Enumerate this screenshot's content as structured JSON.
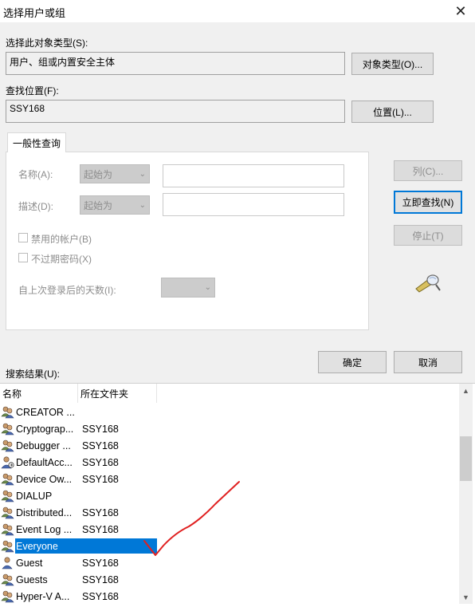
{
  "window": {
    "title": "选择用户或组",
    "close_glyph": "✕"
  },
  "object_type": {
    "label": "选择此对象类型(S):",
    "value": "用户、组或内置安全主体",
    "button": "对象类型(O)..."
  },
  "location": {
    "label": "查找位置(F):",
    "value": "SSY168",
    "button": "位置(L)..."
  },
  "tab": {
    "label": "一般性查询"
  },
  "query": {
    "name_label": "名称(A):",
    "name_combo": "起始为",
    "desc_label": "描述(D):",
    "desc_combo": "起始为",
    "disabled_accounts": "禁用的帐户(B)",
    "non_expiring": "不过期密码(X)",
    "days_label": "自上次登录后的天数(I):"
  },
  "buttons": {
    "columns": "列(C)...",
    "find_now": "立即查找(N)",
    "stop": "停止(T)",
    "ok": "确定",
    "cancel": "取消"
  },
  "results": {
    "label": "搜索结果(U):",
    "columns": [
      "名称",
      "所在文件夹"
    ],
    "rows": [
      {
        "name": "CREATOR ...",
        "folder": "",
        "icon": "group-icon"
      },
      {
        "name": "Cryptograp...",
        "folder": "SSY168",
        "icon": "group-icon"
      },
      {
        "name": "Debugger ...",
        "folder": "SSY168",
        "icon": "group-icon"
      },
      {
        "name": "DefaultAcc...",
        "folder": "SSY168",
        "icon": "user-disabled-icon"
      },
      {
        "name": "Device Ow...",
        "folder": "SSY168",
        "icon": "group-icon"
      },
      {
        "name": "DIALUP",
        "folder": "",
        "icon": "group-icon"
      },
      {
        "name": "Distributed...",
        "folder": "SSY168",
        "icon": "group-icon"
      },
      {
        "name": "Event Log ...",
        "folder": "SSY168",
        "icon": "group-icon"
      },
      {
        "name": "Everyone",
        "folder": "",
        "icon": "group-icon",
        "selected": true
      },
      {
        "name": "Guest",
        "folder": "SSY168",
        "icon": "user-icon"
      },
      {
        "name": "Guests",
        "folder": "SSY168",
        "icon": "group-icon"
      },
      {
        "name": "Hyper-V A...",
        "folder": "SSY168",
        "icon": "group-icon"
      }
    ]
  },
  "colors": {
    "accent": "#0078d7",
    "annotation": "#e02020"
  }
}
